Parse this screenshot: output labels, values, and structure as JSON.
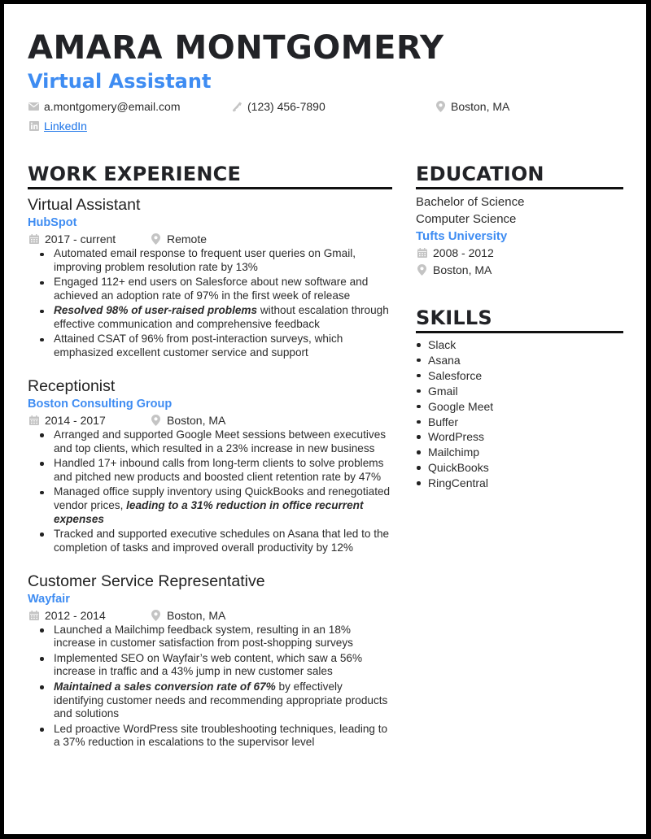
{
  "header": {
    "name": "AMARA MONTGOMERY",
    "title": "Virtual Assistant",
    "accent_color": "#3e8cf2"
  },
  "contact": {
    "email": {
      "icon": "envelope-icon",
      "value": "a.montgomery@email.com"
    },
    "phone": {
      "icon": "phone-icon",
      "value": "(123) 456-7890"
    },
    "location": {
      "icon": "map-pin-icon",
      "value": "Boston, MA"
    },
    "linkedin": {
      "icon": "linkedin-icon",
      "label": "LinkedIn"
    }
  },
  "work_experience": {
    "heading": "WORK EXPERIENCE",
    "jobs": [
      {
        "title": "Virtual Assistant",
        "company": "HubSpot",
        "dates": "2017 - current",
        "location": "Remote",
        "bullets": [
          {
            "bold": "",
            "text": "Automated email response to frequent user queries on Gmail, improving problem resolution rate by 13%"
          },
          {
            "bold": "",
            "text": "Engaged 112+ end users on Salesforce about new software and achieved an adoption rate of 97% in the first week of release"
          },
          {
            "bold": "Resolved 98% of user-raised problems",
            "text": " without escalation through effective communication and comprehensive feedback"
          },
          {
            "bold": "",
            "text": "Attained CSAT of 96% from post-interaction surveys, which emphasized excellent customer service and support"
          }
        ]
      },
      {
        "title": "Receptionist",
        "company": "Boston Consulting Group",
        "dates": "2014 - 2017",
        "location": "Boston, MA",
        "bullets": [
          {
            "bold": "",
            "text": "Arranged and supported Google Meet sessions between executives and top clients, which resulted in a 23% increase in new business"
          },
          {
            "bold": "",
            "text": "Handled 17+ inbound calls from long-term clients to solve problems and pitched new products and boosted client retention rate by 47%"
          },
          {
            "prefix": "Managed office supply inventory using QuickBooks and renegotiated vendor prices, ",
            "bold": "leading to a 31% reduction in office recurrent expenses",
            "text": ""
          },
          {
            "bold": "",
            "text": "Tracked and supported executive schedules on Asana that led to the completion of tasks and improved overall productivity by 12%"
          }
        ]
      },
      {
        "title": "Customer Service Representative",
        "company": "Wayfair",
        "dates": "2012 - 2014",
        "location": "Boston, MA",
        "bullets": [
          {
            "bold": "",
            "text": "Launched a Mailchimp feedback system, resulting in an 18% increase in customer satisfaction from post-shopping surveys"
          },
          {
            "bold": "",
            "text": "Implemented SEO on Wayfair’s web content, which saw a 56% increase in traffic and a 43% jump in new customer sales"
          },
          {
            "bold": "Maintained a sales conversion rate of 67%",
            "text": " by effectively identifying customer needs and recommending appropriate products and solutions"
          },
          {
            "bold": "",
            "text": "Led proactive WordPress site troubleshooting techniques, leading to a 37% reduction in escalations to the supervisor level"
          }
        ]
      }
    ]
  },
  "education": {
    "heading": "EDUCATION",
    "degree": "Bachelor of Science",
    "field": "Computer Science",
    "school": "Tufts University",
    "dates": "2008 - 2012",
    "location": "Boston, MA"
  },
  "skills": {
    "heading": "SKILLS",
    "items": [
      "Slack",
      "Asana",
      "Salesforce",
      "Gmail",
      "Google Meet",
      "Buffer",
      "WordPress",
      "Mailchimp",
      "QuickBooks",
      "RingCentral"
    ]
  }
}
